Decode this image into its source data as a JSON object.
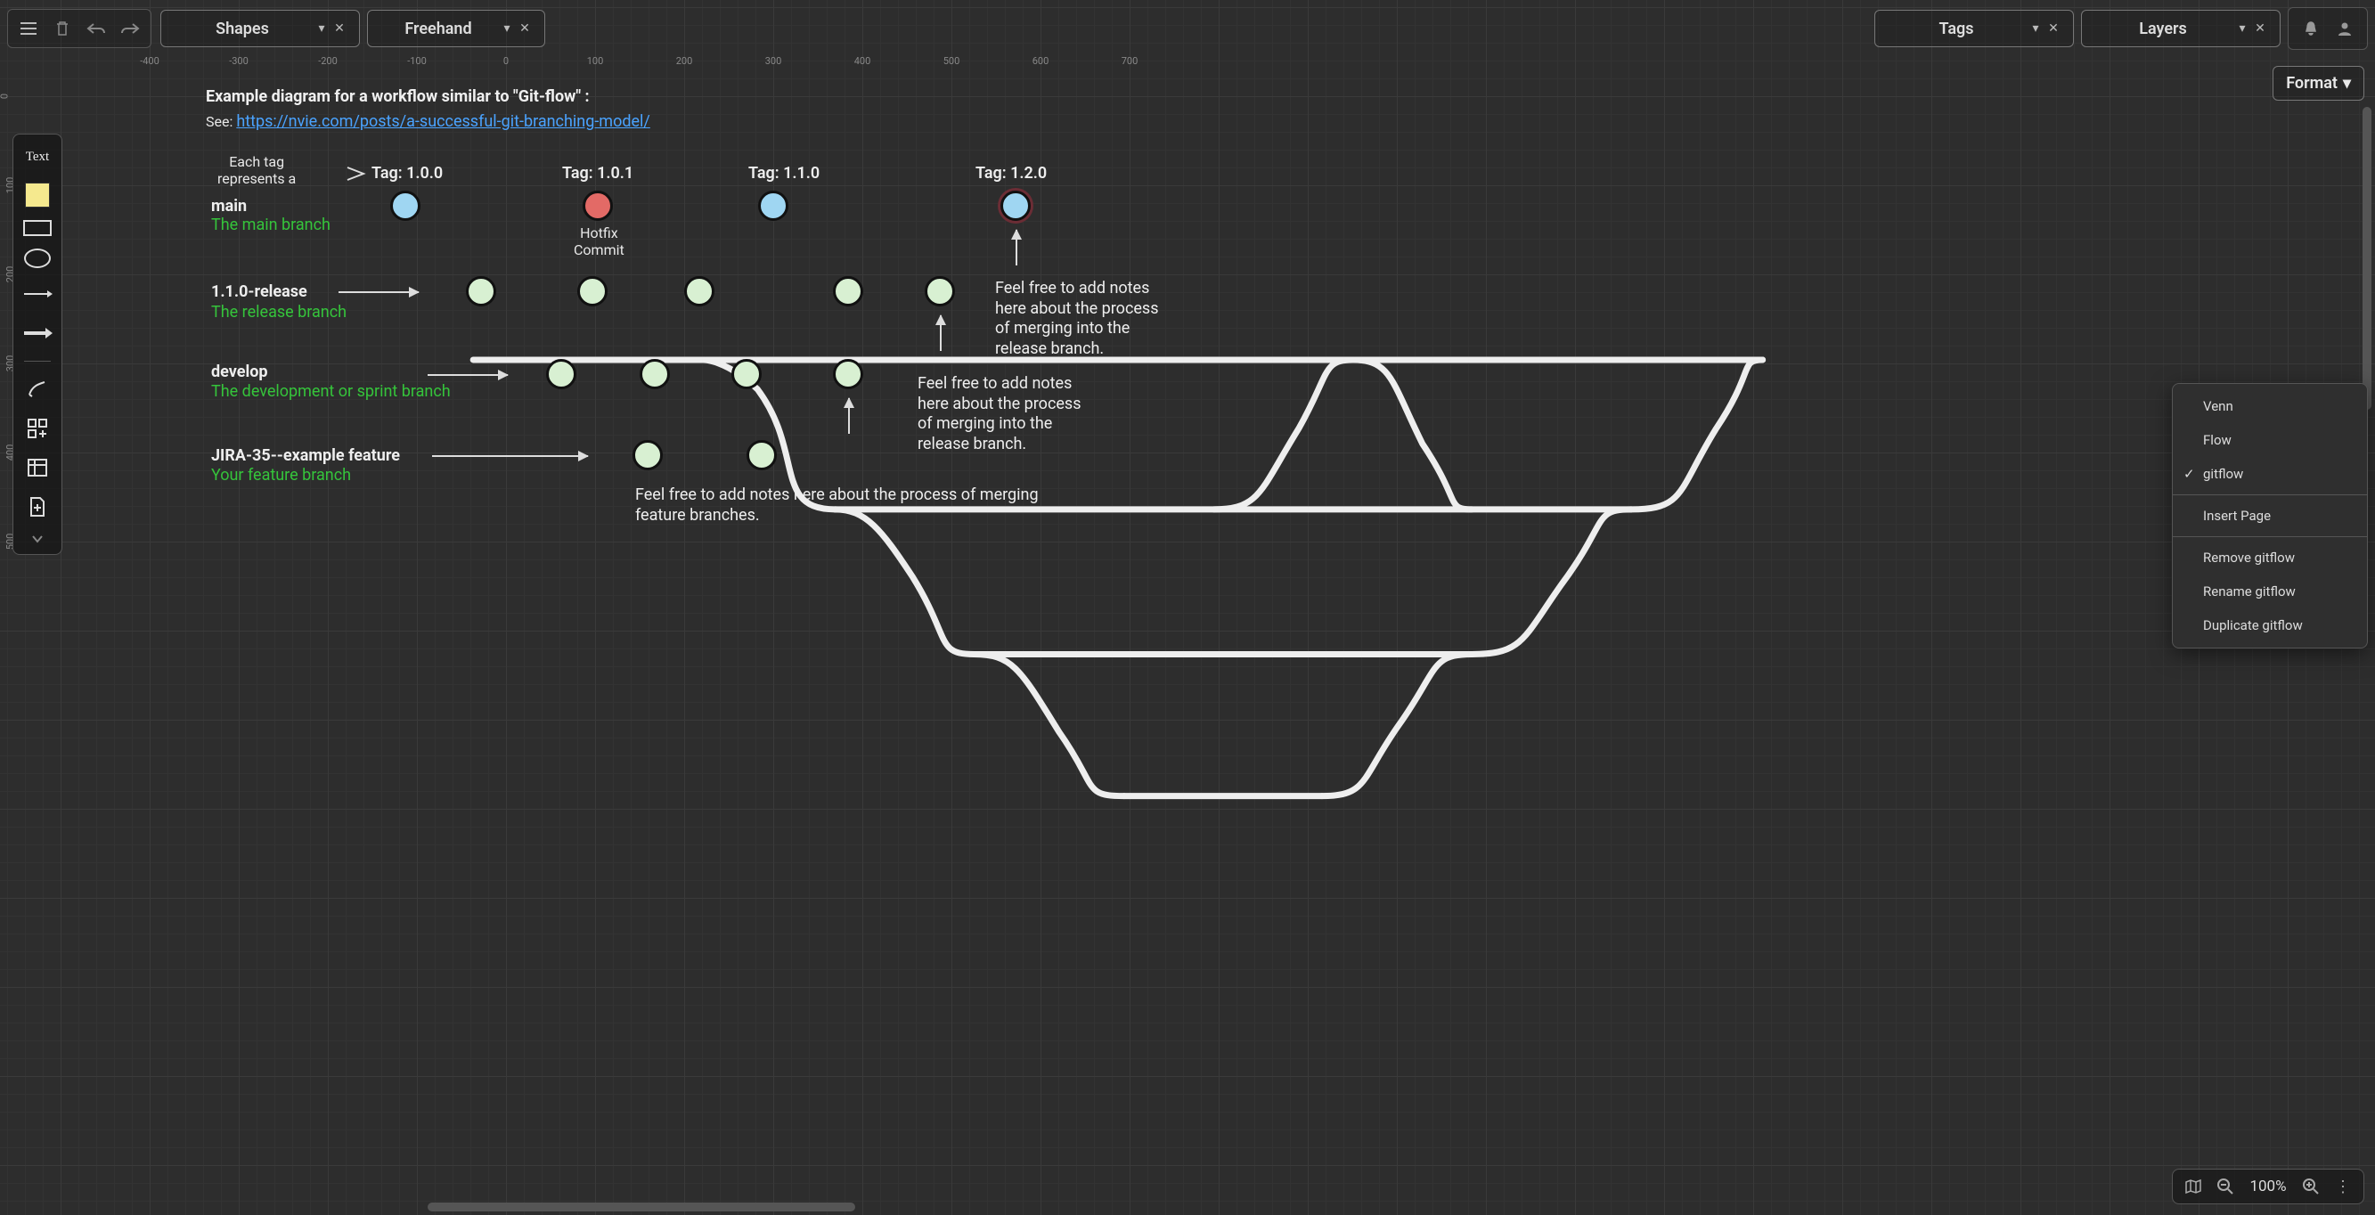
{
  "toolbar": {
    "shapes_label": "Shapes",
    "freehand_label": "Freehand",
    "tags_label": "Tags",
    "layers_label": "Layers",
    "format_label": "Format"
  },
  "palette": {
    "text_label": "Text"
  },
  "ruler_h": [
    "-400",
    "-300",
    "-200",
    "-100",
    "0",
    "100",
    "200",
    "300",
    "400",
    "500",
    "600",
    "700"
  ],
  "ruler_v": [
    "0",
    "100",
    "200",
    "300",
    "400",
    "500"
  ],
  "diagram": {
    "title": "Example diagram for a workflow similar to \"Git-flow\" :",
    "see_label": "See: ",
    "link_text": "https://nvie.com/posts/a-successful-git-branching-model/",
    "tag_note_line1": "Each tag",
    "tag_note_line2": "represents a",
    "tags": {
      "t1": "Tag: 1.0.0",
      "t2": "Tag: 1.0.1",
      "t3": "Tag: 1.1.0",
      "t4": "Tag: 1.2.0"
    },
    "hotfix_l1": "Hotfix",
    "hotfix_l2": "Commit",
    "branches": {
      "main": {
        "name": "main",
        "desc": "The main branch"
      },
      "release": {
        "name": "1.1.0-release",
        "desc": "The release branch"
      },
      "develop": {
        "name": "develop",
        "desc": "The development or sprint branch"
      },
      "feature": {
        "name": "JIRA-35--example feature",
        "desc": "Your feature branch"
      }
    },
    "notes": {
      "n1": "Feel free to add notes here about the process of merging into the release branch.",
      "n2": "Feel free to add notes here about the process of merging into the release branch.",
      "n3": "Feel free to add notes here about the process of merging feature branches."
    }
  },
  "context_menu": {
    "items": [
      "Venn",
      "Flow",
      "gitflow"
    ],
    "checked_index": 2,
    "insert": "Insert Page",
    "remove": "Remove gitflow",
    "rename": "Rename gitflow",
    "duplicate": "Duplicate gitflow"
  },
  "zoom": {
    "level": "100%"
  }
}
